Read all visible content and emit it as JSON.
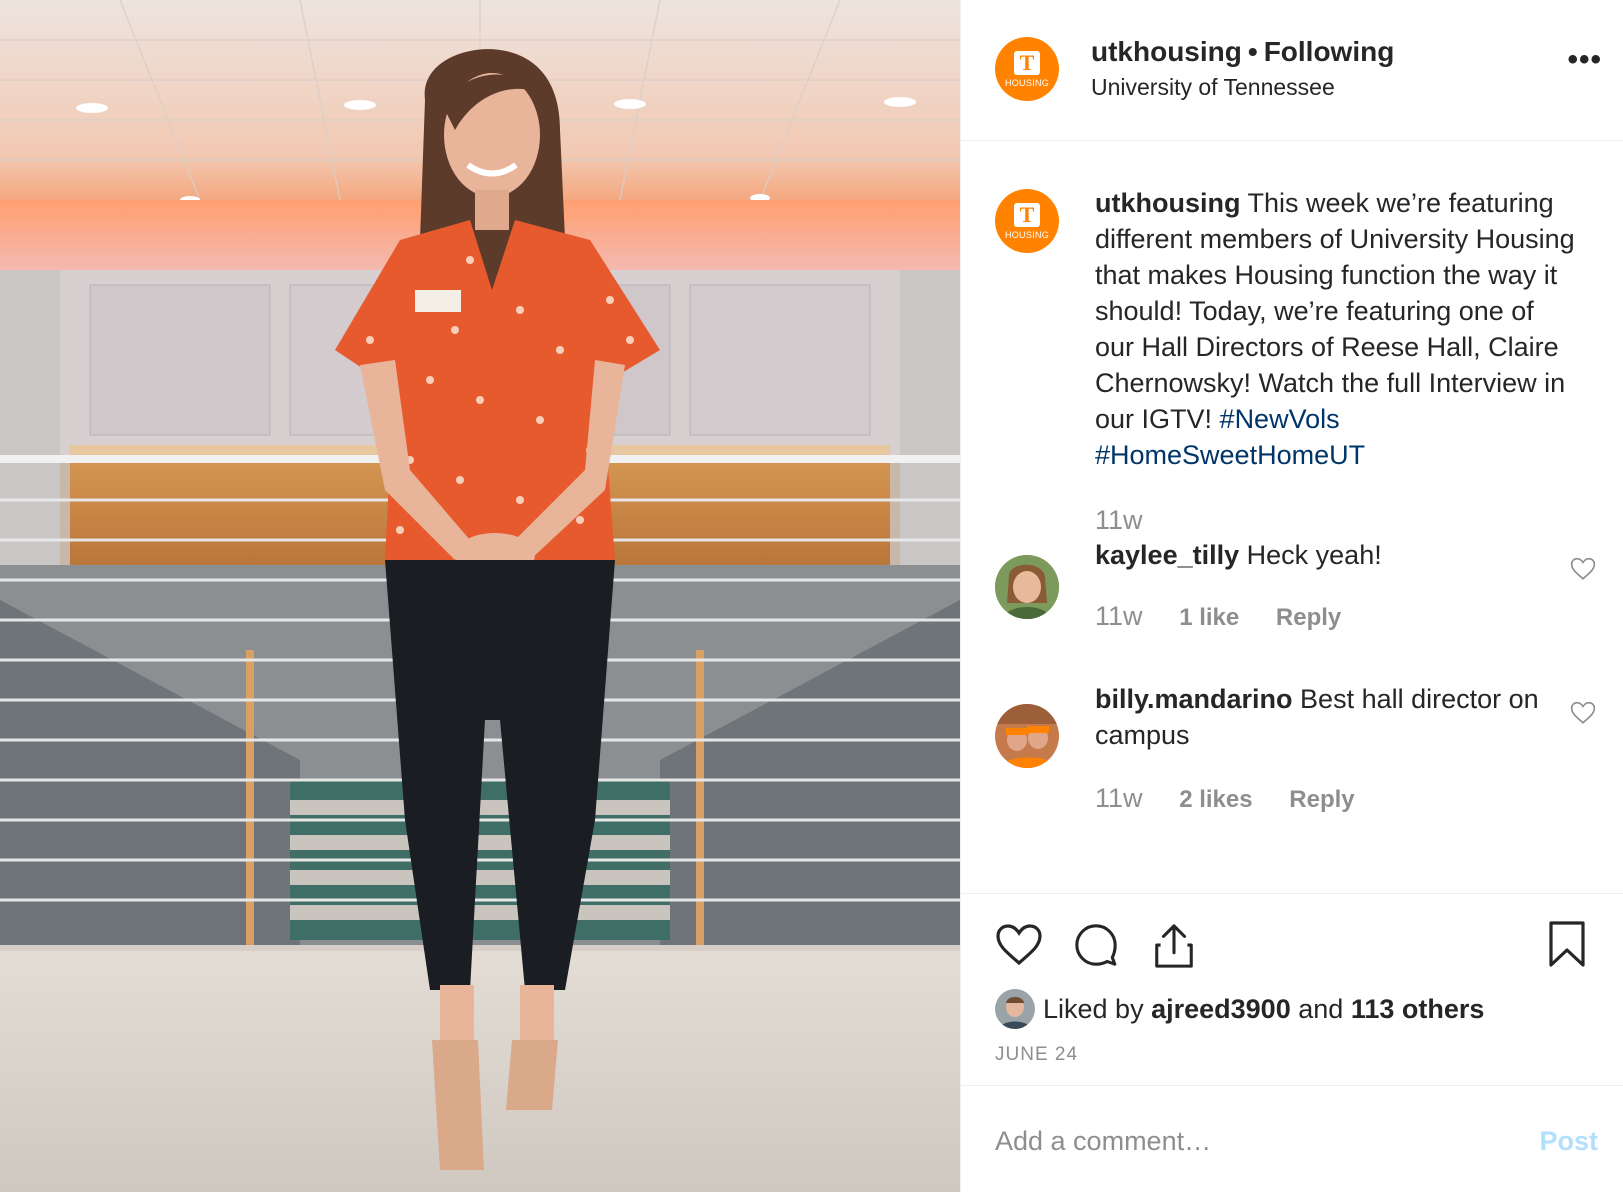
{
  "header": {
    "username": "utkhousing",
    "separator": "•",
    "follow_label": "Following",
    "location": "University of Tennessee",
    "more_label": "•••",
    "logo_letter": "T",
    "logo_text": "HOUSING"
  },
  "caption": {
    "username": "utkhousing",
    "text": "This week we’re featuring different members of University Housing that makes Housing function the way it should! Today, we’re featuring one of our Hall Directors of Reese Hall, Claire Chernowsky! Watch the full Interview in our IGTV!",
    "hashtags": [
      "#NewVols",
      "#HomeSweetHomeUT"
    ],
    "time": "11w"
  },
  "comments": [
    {
      "username": "kaylee_tilly",
      "text": "Heck yeah!",
      "time": "11w",
      "likes": "1 like",
      "reply_label": "Reply"
    },
    {
      "username": "billy.mandarino",
      "text": "Best hall director on campus",
      "time": "11w",
      "likes": "2 likes",
      "reply_label": "Reply"
    }
  ],
  "likes": {
    "prefix": "Liked by",
    "user": "ajreed3900",
    "conj": "and",
    "others": "113 others"
  },
  "date": "JUNE 24",
  "comment_box": {
    "placeholder": "Add a comment…",
    "post_label": "Post"
  },
  "colors": {
    "brand_orange": "#FF8200",
    "hashtag": "#003569",
    "muted": "#8e8e8e",
    "post_disabled": "#b2dffc"
  },
  "icons": [
    "heart-icon",
    "comment-icon",
    "share-icon",
    "bookmark-icon",
    "more-icon"
  ]
}
